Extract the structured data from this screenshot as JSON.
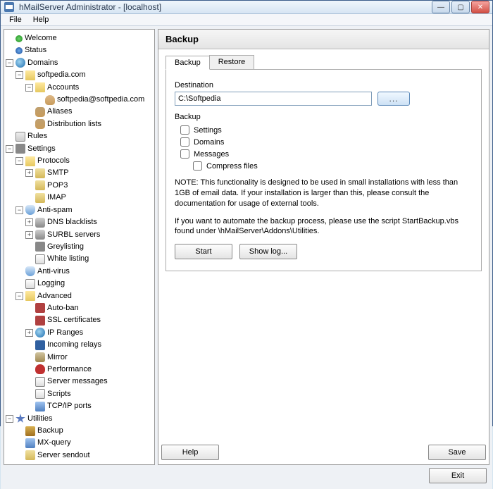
{
  "window": {
    "title": "hMailServer Administrator - [localhost]"
  },
  "menu": {
    "file": "File",
    "help": "Help"
  },
  "tree": {
    "welcome": "Welcome",
    "status": "Status",
    "domains": "Domains",
    "domain1": "softpedia.com",
    "accounts": "Accounts",
    "account1": "softpedia@softpedia.com",
    "aliases": "Aliases",
    "distlists": "Distribution lists",
    "rules": "Rules",
    "settings": "Settings",
    "protocols": "Protocols",
    "smtp": "SMTP",
    "pop3": "POP3",
    "imap": "IMAP",
    "antispam": "Anti-spam",
    "dnsbl": "DNS blacklists",
    "surbl": "SURBL servers",
    "greylist": "Greylisting",
    "whitelist": "White listing",
    "antivirus": "Anti-virus",
    "logging": "Logging",
    "advanced": "Advanced",
    "autoban": "Auto-ban",
    "sslcert": "SSL certificates",
    "ipranges": "IP Ranges",
    "increlay": "Incoming relays",
    "mirror": "Mirror",
    "perf": "Performance",
    "srvmsg": "Server messages",
    "scripts": "Scripts",
    "tcpip": "TCP/IP ports",
    "utilities": "Utilities",
    "backup": "Backup",
    "mxquery": "MX-query",
    "sendout": "Server sendout"
  },
  "panel": {
    "header": "Backup",
    "tab_backup": "Backup",
    "tab_restore": "Restore",
    "dest_label": "Destination",
    "dest_value": "C:\\Softpedia",
    "backup_label": "Backup",
    "chk_settings": "Settings",
    "chk_domains": "Domains",
    "chk_messages": "Messages",
    "chk_compress": "Compress files",
    "note1": "NOTE: This functionality is designed to be used in small installations with less than 1GB of email data. If your  installation is larger than this, please consult the documentation for usage of external tools.",
    "note2": "If you want to automate the backup process, please use the script StartBackup.vbs found under \\hMailServer\\Addons\\Utilities.",
    "start_btn": "Start",
    "showlog_btn": "Show log..."
  },
  "footer": {
    "help": "Help",
    "save": "Save",
    "exit": "Exit"
  }
}
